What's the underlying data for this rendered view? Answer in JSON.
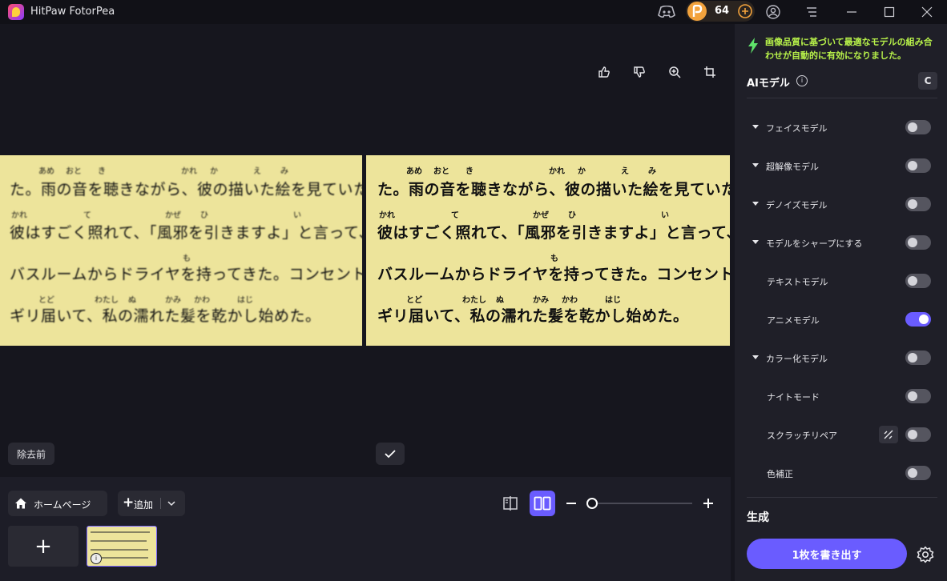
{
  "app": {
    "title": "HitPaw FotorPea",
    "credits": "64"
  },
  "canvas": {
    "lines": [
      {
        "ruby": [
          [
            "あめ",
            48
          ],
          [
            "おと",
            82
          ],
          [
            "き",
            122
          ],
          [
            "かれ",
            226
          ],
          [
            "か",
            262
          ],
          [
            "え",
            316
          ],
          [
            "み",
            350
          ]
        ],
        "text": "た。雨の音を聴きながら、彼の描いた絵を見ていたら、"
      },
      {
        "ruby": [
          [
            "かれ",
            14
          ],
          [
            "て",
            104
          ],
          [
            "かぜ",
            206
          ],
          [
            "ひ",
            250
          ],
          [
            "い",
            366
          ]
        ],
        "text": "彼はすごく照れて、「風邪を引きますよ」と言って、"
      },
      {
        "ruby": [
          [
            "も",
            228
          ]
        ],
        "text": "バスルームからドライヤを持ってきた。コンセントが"
      },
      {
        "ruby": [
          [
            "とど",
            48
          ],
          [
            "わたし",
            118
          ],
          [
            "ぬ",
            160
          ],
          [
            "かみ",
            206
          ],
          [
            "かわ",
            242
          ],
          [
            "はじ",
            296
          ]
        ],
        "text": "ギリ届いて、私の濡れた髪を乾かし始めた。"
      }
    ],
    "before_label": "除去前"
  },
  "bottom": {
    "home_label": "ホームページ",
    "add_label": "追加"
  },
  "panel": {
    "notice": "画像品質に基づいて最適なモデルの組み合わせが自動的に有効になりました。",
    "ai_title": "AIモデル",
    "reset_label": "C",
    "models": [
      {
        "label": "フェイスモデル",
        "expand": true,
        "on": false
      },
      {
        "label": "超解像モデル",
        "expand": true,
        "on": false
      },
      {
        "label": "デノイズモデル",
        "expand": true,
        "on": false
      },
      {
        "label": "モデルをシャープにする",
        "expand": true,
        "on": false
      },
      {
        "label": "テキストモデル",
        "expand": false,
        "on": false
      },
      {
        "label": "アニメモデル",
        "expand": false,
        "on": true
      },
      {
        "label": "カラー化モデル",
        "expand": true,
        "on": false
      },
      {
        "label": "ナイトモード",
        "expand": false,
        "on": false
      },
      {
        "label": "スクラッチリペア",
        "expand": false,
        "on": false,
        "extra_icon": "scratch-repair-icon"
      },
      {
        "label": "色補正",
        "expand": false,
        "on": false
      }
    ],
    "generate_title": "生成",
    "export_label": "1枚を書き出す"
  },
  "colors": {
    "accent": "#6a5cff",
    "notice": "#b8f24a",
    "image_bg": "#ede49b",
    "coin": "#f2a23c"
  }
}
